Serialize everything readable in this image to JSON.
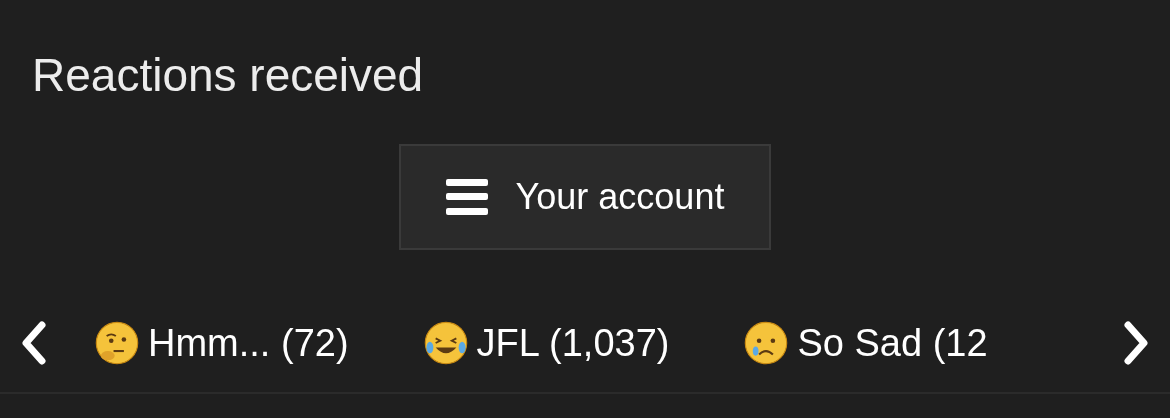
{
  "title": "Reactions received",
  "account_button": {
    "label": "Your account"
  },
  "reactions": [
    {
      "kind": "thinking",
      "label": "Hmm... (72)"
    },
    {
      "kind": "laughing",
      "label": "JFL (1,037)"
    },
    {
      "kind": "sad",
      "label": "So Sad (12"
    }
  ]
}
